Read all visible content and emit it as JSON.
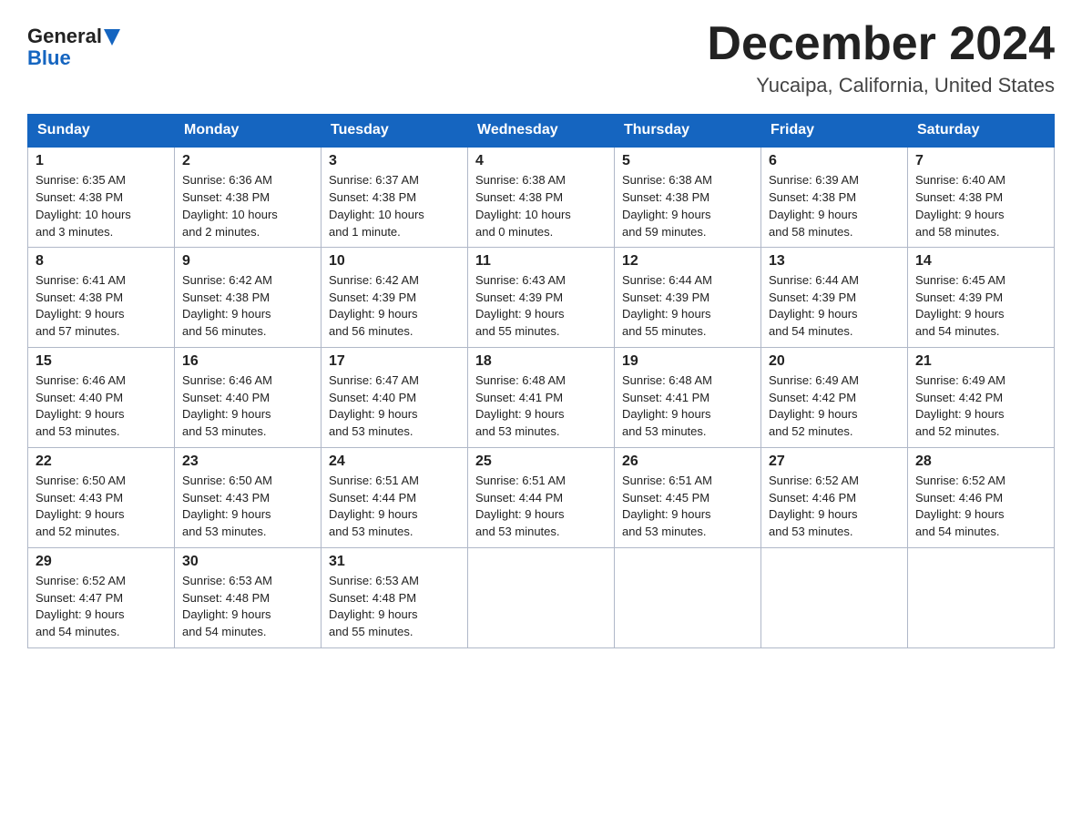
{
  "header": {
    "logo_line1": "General",
    "logo_line2": "Blue",
    "month_title": "December 2024",
    "location": "Yucaipa, California, United States"
  },
  "weekdays": [
    "Sunday",
    "Monday",
    "Tuesday",
    "Wednesday",
    "Thursday",
    "Friday",
    "Saturday"
  ],
  "weeks": [
    [
      {
        "day": "1",
        "info": "Sunrise: 6:35 AM\nSunset: 4:38 PM\nDaylight: 10 hours\nand 3 minutes."
      },
      {
        "day": "2",
        "info": "Sunrise: 6:36 AM\nSunset: 4:38 PM\nDaylight: 10 hours\nand 2 minutes."
      },
      {
        "day": "3",
        "info": "Sunrise: 6:37 AM\nSunset: 4:38 PM\nDaylight: 10 hours\nand 1 minute."
      },
      {
        "day": "4",
        "info": "Sunrise: 6:38 AM\nSunset: 4:38 PM\nDaylight: 10 hours\nand 0 minutes."
      },
      {
        "day": "5",
        "info": "Sunrise: 6:38 AM\nSunset: 4:38 PM\nDaylight: 9 hours\nand 59 minutes."
      },
      {
        "day": "6",
        "info": "Sunrise: 6:39 AM\nSunset: 4:38 PM\nDaylight: 9 hours\nand 58 minutes."
      },
      {
        "day": "7",
        "info": "Sunrise: 6:40 AM\nSunset: 4:38 PM\nDaylight: 9 hours\nand 58 minutes."
      }
    ],
    [
      {
        "day": "8",
        "info": "Sunrise: 6:41 AM\nSunset: 4:38 PM\nDaylight: 9 hours\nand 57 minutes."
      },
      {
        "day": "9",
        "info": "Sunrise: 6:42 AM\nSunset: 4:38 PM\nDaylight: 9 hours\nand 56 minutes."
      },
      {
        "day": "10",
        "info": "Sunrise: 6:42 AM\nSunset: 4:39 PM\nDaylight: 9 hours\nand 56 minutes."
      },
      {
        "day": "11",
        "info": "Sunrise: 6:43 AM\nSunset: 4:39 PM\nDaylight: 9 hours\nand 55 minutes."
      },
      {
        "day": "12",
        "info": "Sunrise: 6:44 AM\nSunset: 4:39 PM\nDaylight: 9 hours\nand 55 minutes."
      },
      {
        "day": "13",
        "info": "Sunrise: 6:44 AM\nSunset: 4:39 PM\nDaylight: 9 hours\nand 54 minutes."
      },
      {
        "day": "14",
        "info": "Sunrise: 6:45 AM\nSunset: 4:39 PM\nDaylight: 9 hours\nand 54 minutes."
      }
    ],
    [
      {
        "day": "15",
        "info": "Sunrise: 6:46 AM\nSunset: 4:40 PM\nDaylight: 9 hours\nand 53 minutes."
      },
      {
        "day": "16",
        "info": "Sunrise: 6:46 AM\nSunset: 4:40 PM\nDaylight: 9 hours\nand 53 minutes."
      },
      {
        "day": "17",
        "info": "Sunrise: 6:47 AM\nSunset: 4:40 PM\nDaylight: 9 hours\nand 53 minutes."
      },
      {
        "day": "18",
        "info": "Sunrise: 6:48 AM\nSunset: 4:41 PM\nDaylight: 9 hours\nand 53 minutes."
      },
      {
        "day": "19",
        "info": "Sunrise: 6:48 AM\nSunset: 4:41 PM\nDaylight: 9 hours\nand 53 minutes."
      },
      {
        "day": "20",
        "info": "Sunrise: 6:49 AM\nSunset: 4:42 PM\nDaylight: 9 hours\nand 52 minutes."
      },
      {
        "day": "21",
        "info": "Sunrise: 6:49 AM\nSunset: 4:42 PM\nDaylight: 9 hours\nand 52 minutes."
      }
    ],
    [
      {
        "day": "22",
        "info": "Sunrise: 6:50 AM\nSunset: 4:43 PM\nDaylight: 9 hours\nand 52 minutes."
      },
      {
        "day": "23",
        "info": "Sunrise: 6:50 AM\nSunset: 4:43 PM\nDaylight: 9 hours\nand 53 minutes."
      },
      {
        "day": "24",
        "info": "Sunrise: 6:51 AM\nSunset: 4:44 PM\nDaylight: 9 hours\nand 53 minutes."
      },
      {
        "day": "25",
        "info": "Sunrise: 6:51 AM\nSunset: 4:44 PM\nDaylight: 9 hours\nand 53 minutes."
      },
      {
        "day": "26",
        "info": "Sunrise: 6:51 AM\nSunset: 4:45 PM\nDaylight: 9 hours\nand 53 minutes."
      },
      {
        "day": "27",
        "info": "Sunrise: 6:52 AM\nSunset: 4:46 PM\nDaylight: 9 hours\nand 53 minutes."
      },
      {
        "day": "28",
        "info": "Sunrise: 6:52 AM\nSunset: 4:46 PM\nDaylight: 9 hours\nand 54 minutes."
      }
    ],
    [
      {
        "day": "29",
        "info": "Sunrise: 6:52 AM\nSunset: 4:47 PM\nDaylight: 9 hours\nand 54 minutes."
      },
      {
        "day": "30",
        "info": "Sunrise: 6:53 AM\nSunset: 4:48 PM\nDaylight: 9 hours\nand 54 minutes."
      },
      {
        "day": "31",
        "info": "Sunrise: 6:53 AM\nSunset: 4:48 PM\nDaylight: 9 hours\nand 55 minutes."
      },
      {
        "day": "",
        "info": ""
      },
      {
        "day": "",
        "info": ""
      },
      {
        "day": "",
        "info": ""
      },
      {
        "day": "",
        "info": ""
      }
    ]
  ]
}
